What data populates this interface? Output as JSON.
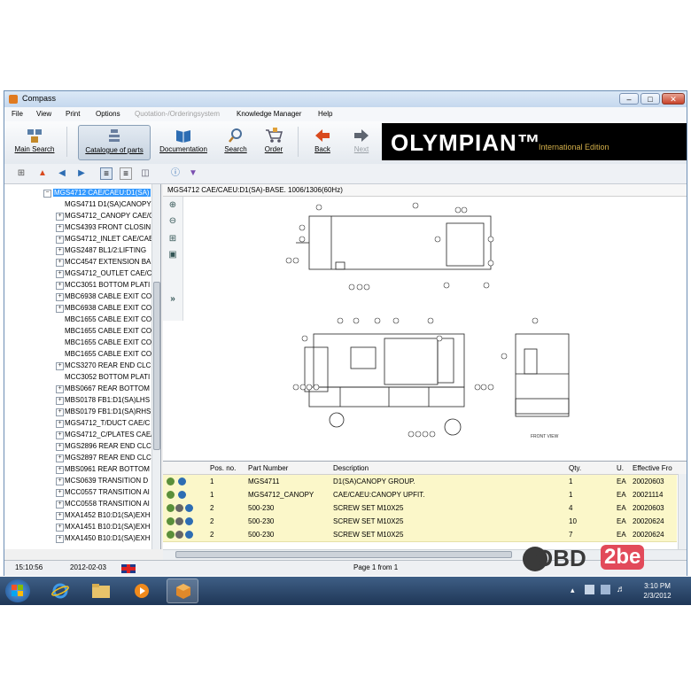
{
  "window": {
    "title": "Compass",
    "min_glyph": "–",
    "max_glyph": "□",
    "close_glyph": "✕"
  },
  "menu": [
    {
      "label": "File"
    },
    {
      "label": "View"
    },
    {
      "label": "Print"
    },
    {
      "label": "Options"
    },
    {
      "label": "Quotation-/Orderingsystem",
      "disabled": true
    },
    {
      "label": "Knowledge Manager"
    },
    {
      "label": "Help"
    }
  ],
  "toolbar": {
    "main_search": "Main Search",
    "catalogue": "Catalogue of parts",
    "documentation": "Documentation",
    "search": "Search",
    "order": "Order",
    "back": "Back",
    "next": "Next"
  },
  "brand": {
    "name": "OLYMPIAN™",
    "edition": "International Edition"
  },
  "tree": {
    "items": [
      {
        "text": "MGS4712 CAE/CAEU:D1(SA)",
        "pm": "−",
        "indent": 1,
        "selected": true
      },
      {
        "text": "MGS4711 D1(SA)CANOPY",
        "pm": "",
        "indent": 2
      },
      {
        "text": "MGS4712_CANOPY CAE/C",
        "pm": "+",
        "indent": 2
      },
      {
        "text": "MCS4393 FRONT CLOSIN",
        "pm": "+",
        "indent": 2
      },
      {
        "text": "MGS4712_INLET CAE/CAE",
        "pm": "+",
        "indent": 2
      },
      {
        "text": "MGS2487 BL1/2:LIFTING",
        "pm": "+",
        "indent": 2
      },
      {
        "text": "MCC4547 EXTENSION BA",
        "pm": "+",
        "indent": 2
      },
      {
        "text": "MGS4712_OUTLET CAE/C",
        "pm": "+",
        "indent": 2
      },
      {
        "text": "MCC3051 BOTTOM PLATI",
        "pm": "+",
        "indent": 2
      },
      {
        "text": "MBC6938 CABLE EXIT CO",
        "pm": "+",
        "indent": 2
      },
      {
        "text": "MBC6938 CABLE EXIT CO",
        "pm": "+",
        "indent": 2
      },
      {
        "text": "MBC1655 CABLE EXIT CO",
        "pm": "",
        "indent": 2
      },
      {
        "text": "MBC1655 CABLE EXIT CO",
        "pm": "",
        "indent": 2
      },
      {
        "text": "MBC1655 CABLE EXIT CO",
        "pm": "",
        "indent": 2
      },
      {
        "text": "MBC1655 CABLE EXIT CO",
        "pm": "",
        "indent": 2
      },
      {
        "text": "MCS3270 REAR END CLC",
        "pm": "+",
        "indent": 2
      },
      {
        "text": "MCC3052 BOTTOM PLATI",
        "pm": "",
        "indent": 2
      },
      {
        "text": "MBS0667 REAR BOTTOM",
        "pm": "+",
        "indent": 2
      },
      {
        "text": "MBS0178 FB1:D1(SA)LHS",
        "pm": "+",
        "indent": 2
      },
      {
        "text": "MBS0179 FB1:D1(SA)RHS",
        "pm": "+",
        "indent": 2
      },
      {
        "text": "MGS4712_T/DUCT CAE/C",
        "pm": "+",
        "indent": 2
      },
      {
        "text": "MGS4712_C/PLATES CAE/",
        "pm": "+",
        "indent": 2
      },
      {
        "text": "MGS2896 REAR END CLC",
        "pm": "+",
        "indent": 2
      },
      {
        "text": "MGS2897 REAR END CLC",
        "pm": "+",
        "indent": 2
      },
      {
        "text": "MBS0961 REAR BOTTOM",
        "pm": "+",
        "indent": 2
      },
      {
        "text": "MCS0639 TRANSITION D",
        "pm": "+",
        "indent": 2
      },
      {
        "text": "MCC0557 TRANSITION AI",
        "pm": "+",
        "indent": 2
      },
      {
        "text": "MCC0558 TRANSITION AI",
        "pm": "+",
        "indent": 2
      },
      {
        "text": "MXA1452 B10:D1(SA)EXH",
        "pm": "+",
        "indent": 2
      },
      {
        "text": "MXA1451 B10:D1(SA)EXH",
        "pm": "+",
        "indent": 2
      },
      {
        "text": "MXA1450 B10:D1(SA)EXH",
        "pm": "+",
        "indent": 2
      }
    ]
  },
  "drawing": {
    "header": "MGS4712 CAE/CAEU:D1(SA)-BASE. 1006/1306(60Hz)",
    "expand_glyph": "»",
    "front_view_label": "FRONT VIEW"
  },
  "parts": {
    "columns": [
      "Pos. no.",
      "Part Number",
      "Description",
      "Qty.",
      "U.",
      "Effective Fro"
    ],
    "rows": [
      {
        "pos": "1",
        "part": "MGS4711",
        "desc": "D1(SA)CANOPY GROUP.",
        "qty": "1",
        "unit": "EA",
        "eff": "20020603",
        "cart": false
      },
      {
        "pos": "1",
        "part": "MGS4712_CANOPY",
        "desc": "CAE/CAEU:CANOPY UPFIT.",
        "qty": "1",
        "unit": "EA",
        "eff": "20021114",
        "cart": false
      },
      {
        "pos": "2",
        "part": "500-230",
        "desc": "SCREW SET M10X25",
        "qty": "4",
        "unit": "EA",
        "eff": "20020603",
        "cart": true
      },
      {
        "pos": "2",
        "part": "500-230",
        "desc": "SCREW SET M10X25",
        "qty": "10",
        "unit": "EA",
        "eff": "20020624",
        "cart": true
      },
      {
        "pos": "2",
        "part": "500-230",
        "desc": "SCREW SET M10X25",
        "qty": "7",
        "unit": "EA",
        "eff": "20020624",
        "cart": true
      }
    ]
  },
  "status": {
    "time": "15:10:56",
    "date": "2012-02-03",
    "page": "Page 1 from 1"
  },
  "taskbar": {
    "time": "3:10 PM",
    "date": "2/3/2012"
  },
  "watermark": {
    "text_a": "OBD",
    "text_b": "2be"
  },
  "colors": {
    "accent": "#3399ff",
    "brand_bg": "#000000",
    "brand_edition": "#d4b04a",
    "row_highlight": "#fbf7c9"
  }
}
